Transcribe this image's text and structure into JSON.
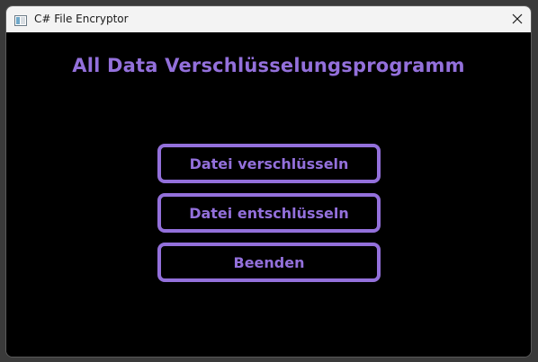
{
  "window": {
    "title": "C# File Encryptor",
    "app_icon": "window-app-icon",
    "close_icon": "close-icon"
  },
  "main": {
    "heading": "All Data Verschlüsselungsprogramm",
    "buttons": {
      "encrypt_label": "Datei verschlüsseln",
      "decrypt_label": "Datei entschlüsseln",
      "exit_label": "Beenden"
    }
  },
  "colors": {
    "accent": "#9370db",
    "background": "#000000",
    "titlebar": "#f3f3f3"
  }
}
